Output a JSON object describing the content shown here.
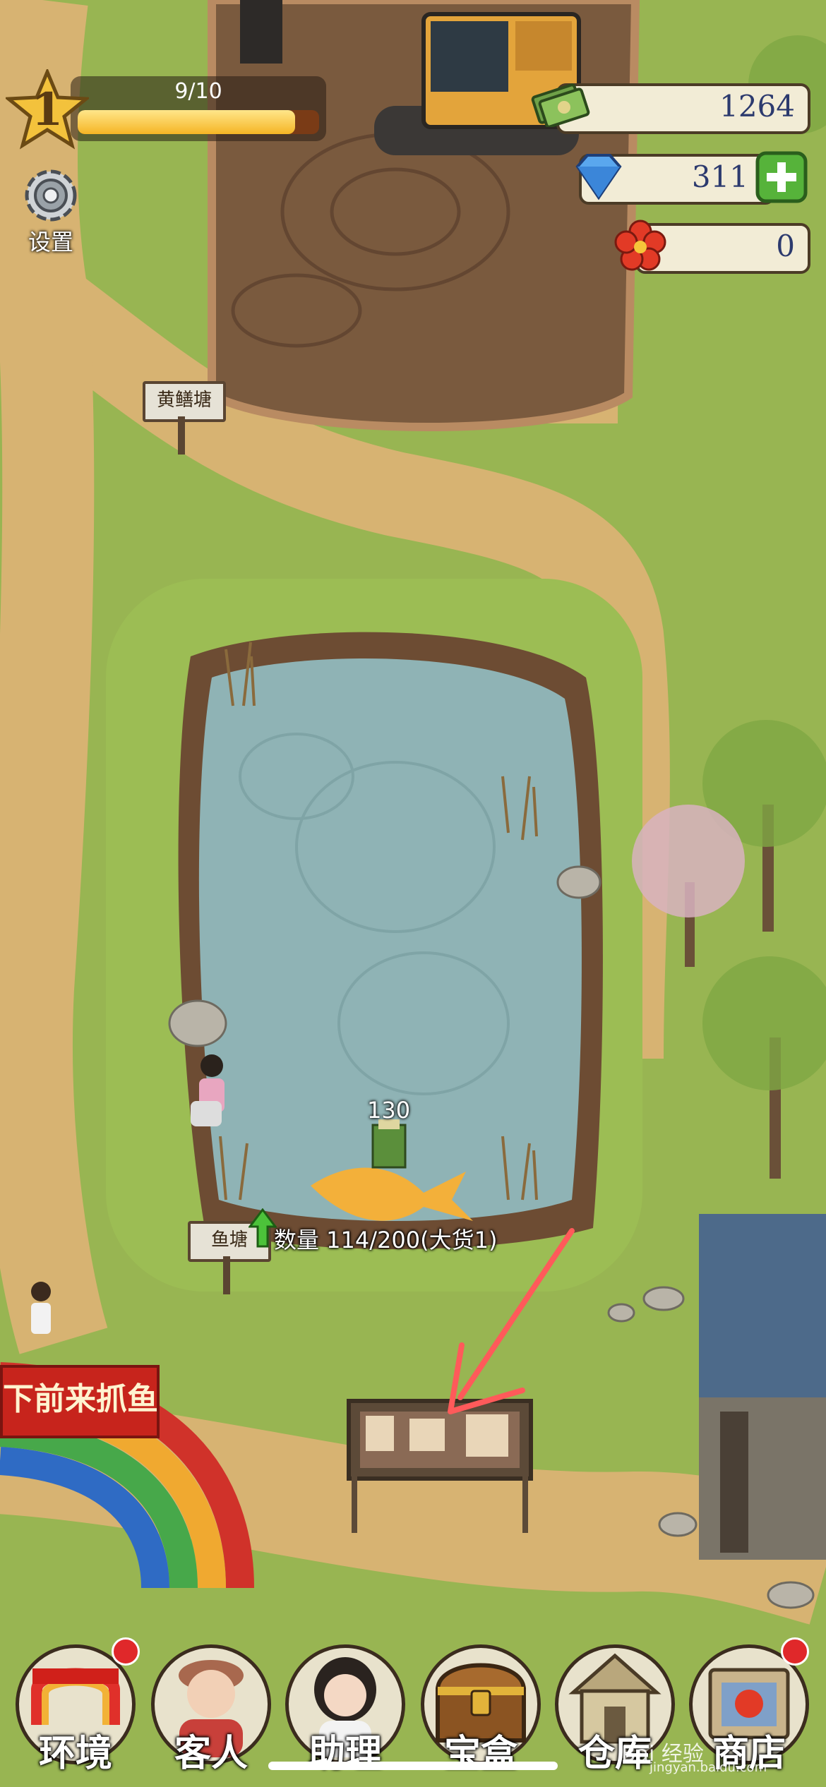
{
  "hud": {
    "level": "1",
    "xp_text": "9/10",
    "xp_progress": 0.9,
    "cash": "1264",
    "diamonds": "311",
    "flowers": "0",
    "settings_label": "设置"
  },
  "map": {
    "eel_pond_sign": "黄鳝塘",
    "fish_pond_sign": "鱼塘",
    "pond_status": "数量 114/200(大货1)",
    "money_ready": "130",
    "banner_text": "下前来抓鱼"
  },
  "nav": {
    "items": [
      {
        "label": "环境",
        "icon": "environment-gate-icon",
        "badge": true
      },
      {
        "label": "客人",
        "icon": "customer-avatar-icon",
        "badge": false
      },
      {
        "label": "助理",
        "icon": "assistant-avatar-icon",
        "badge": false
      },
      {
        "label": "宝盒",
        "icon": "treasure-chest-icon",
        "badge": false
      },
      {
        "label": "仓库",
        "icon": "warehouse-icon",
        "badge": false
      },
      {
        "label": "商店",
        "icon": "shop-icon",
        "badge": true
      }
    ]
  },
  "watermark": {
    "text": "Bai 经验",
    "sub": "jingyan.baidu.com"
  },
  "colors": {
    "grass": "#8fae4a",
    "dirt_path": "#d9b679",
    "water": "#8fb3b5",
    "annotation_arrow": "#ff5a5a"
  }
}
